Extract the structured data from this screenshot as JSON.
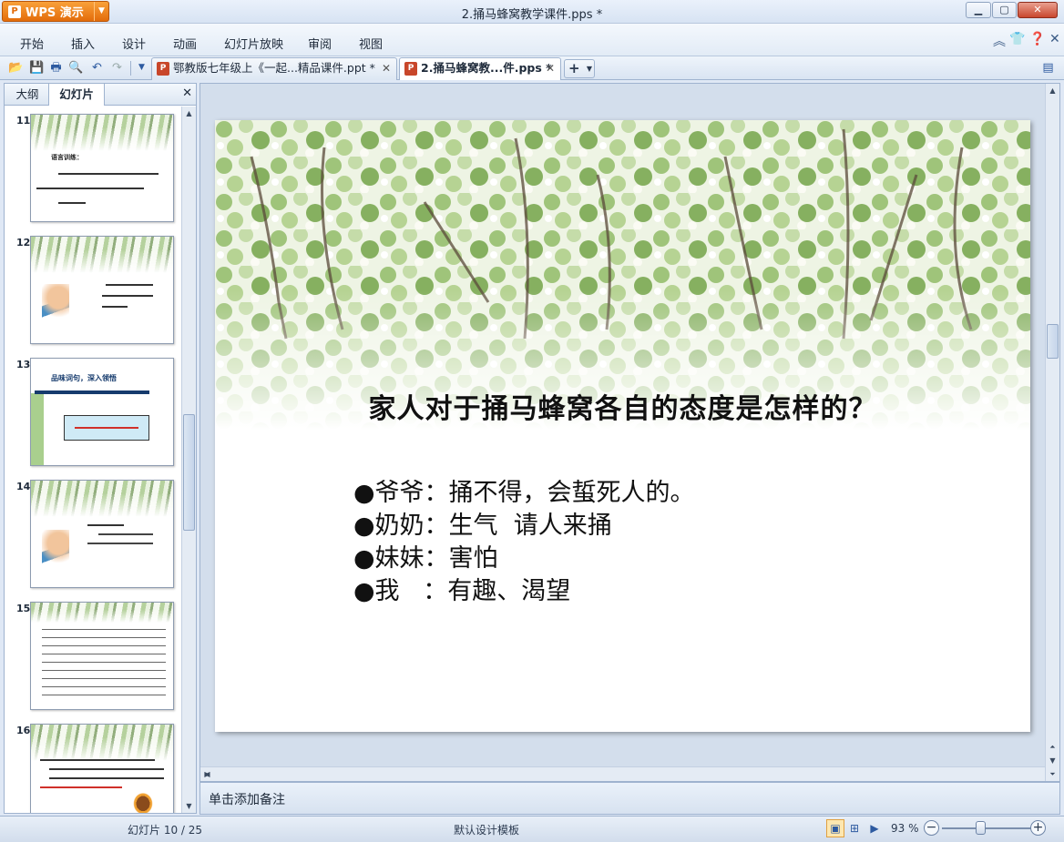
{
  "app": {
    "name": "WPS 演示",
    "logo": "P"
  },
  "window": {
    "title": "2.捅马蜂窝教学课件.pps *"
  },
  "menu": [
    "开始",
    "插入",
    "设计",
    "动画",
    "幻灯片放映",
    "审阅",
    "视图"
  ],
  "tabs": [
    {
      "label": "鄂教版七年级上《一起...精品课件.ppt *"
    },
    {
      "label": "2.捅马蜂窝教...件.pps *"
    }
  ],
  "left_panel": {
    "tabs": [
      "大纲",
      "幻灯片"
    ],
    "thumbs": [
      {
        "num": "11"
      },
      {
        "num": "12"
      },
      {
        "num": "13"
      },
      {
        "num": "14"
      },
      {
        "num": "15"
      },
      {
        "num": "16"
      }
    ]
  },
  "slide": {
    "title": "家人对于捅马蜂窝各自的态度是怎样的？",
    "bullets": [
      "●爷爷：捅不得，会蜇死人的。",
      "●奶奶：生气  请人来捅",
      "●妹妹：害怕",
      "●我   ：有趣、渴望"
    ]
  },
  "notes": {
    "placeholder": "单击添加备注"
  },
  "status": {
    "slide_info": "幻灯片 10 / 25",
    "template": "默认设计模板",
    "zoom": "93 %"
  }
}
